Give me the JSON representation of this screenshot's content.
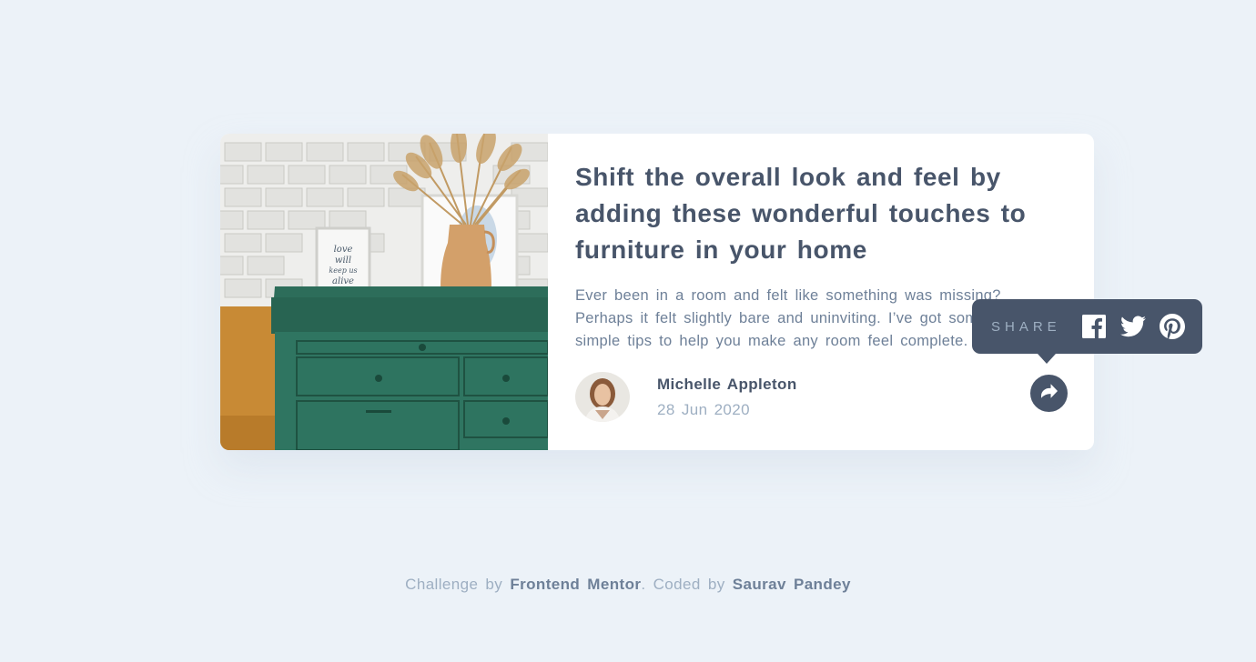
{
  "article": {
    "title": "Shift the overall look and feel by adding these wonderful touches to furniture in your home",
    "description": "Ever been in a room and felt like something was missing? Perhaps it felt slightly bare and uninviting. I’ve got some simple tips to help you make any room feel complete."
  },
  "author": {
    "name": "Michelle Appleton",
    "date": "28 Jun 2020"
  },
  "share": {
    "label": "SHARE",
    "icons": [
      "facebook-icon",
      "twitter-icon",
      "pinterest-icon",
      "share-icon"
    ]
  },
  "footer": {
    "prefix": "Challenge by",
    "challenge_link": "Frontend Mentor",
    "middle": ". Coded by",
    "author_link": "Saurav Pandey"
  },
  "colors": {
    "background": "#ecf2f8",
    "card": "#ffffff",
    "dark": "#48556a",
    "muted": "#6e8098",
    "light": "#9eafc2"
  }
}
